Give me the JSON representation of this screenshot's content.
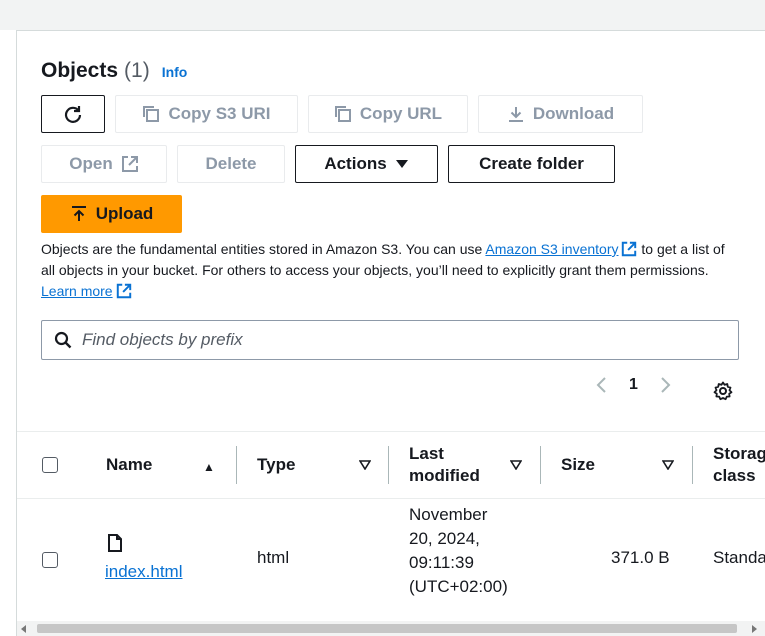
{
  "header": {
    "title": "Objects",
    "count": "(1)",
    "info": "Info"
  },
  "toolbar": {
    "copy_s3_uri": "Copy S3 URI",
    "copy_url": "Copy URL",
    "download": "Download",
    "open": "Open",
    "delete": "Delete",
    "actions": "Actions",
    "create_folder": "Create folder",
    "upload": "Upload"
  },
  "description": {
    "part1": "Objects are the fundamental entities stored in Amazon S3. You can use ",
    "link1": "Amazon S3 inventory",
    "part2": " to get a list of all objects in your bucket. For others to access your objects, you’ll need to explicitly grant them permissions. ",
    "link2": "Learn more"
  },
  "search": {
    "placeholder": "Find objects by prefix"
  },
  "pagination": {
    "current_page": "1"
  },
  "table": {
    "columns": {
      "name": "Name",
      "type": "Type",
      "last_modified_1": "Last",
      "last_modified_2": "modified",
      "size": "Size",
      "storage_1": "Storag",
      "storage_2": "class"
    },
    "rows": [
      {
        "name": "index.html",
        "type": "html",
        "date_1": "November",
        "date_2": "20, 2024,",
        "date_3": "09:11:39",
        "date_4": "(UTC+02:00)",
        "size": "371.0 B",
        "storage": "Standa"
      }
    ]
  },
  "colors": {
    "accent": "#0972d3",
    "primary": "#ff9900",
    "disabled": "#8d99a8"
  }
}
